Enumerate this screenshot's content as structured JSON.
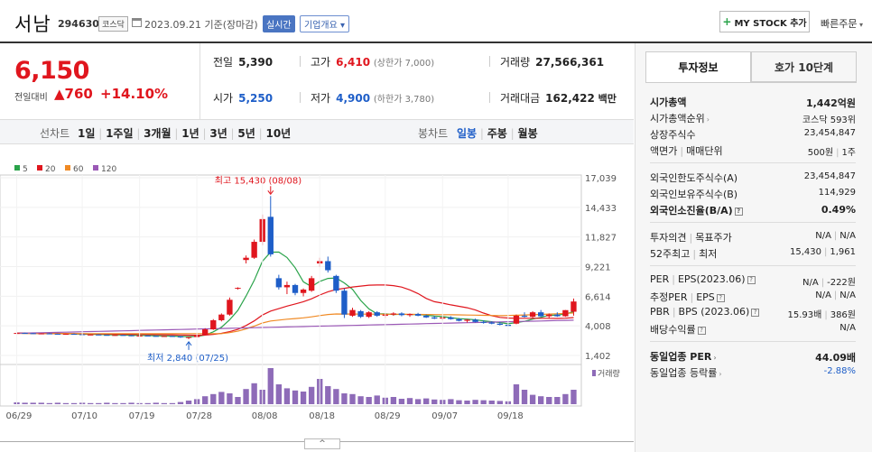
{
  "header": {
    "stock_name": "서남",
    "stock_code": "294630",
    "market": "코스닥",
    "date": "2023.09.21 기준(장마감)",
    "realtime_label": "실시간",
    "company_label": "기업개요",
    "mystock_label": "MY STOCK 추가",
    "quick_order_label": "빠른주문"
  },
  "price": {
    "current": "6,150",
    "change_label": "전일대비",
    "change_value": "760",
    "change_pct": "+14.10%",
    "prev_close_label": "전일",
    "prev_close": "5,390",
    "high_label": "고가",
    "high": "6,410",
    "upper_limit": "(상한가 7,000)",
    "volume_label": "거래량",
    "volume": "27,566,361",
    "open_label": "시가",
    "open": "5,250",
    "low_label": "저가",
    "low": "4,900",
    "lower_limit": "(하한가 3,780)",
    "amount_label": "거래대금",
    "amount": "162,422",
    "amount_unit": "백만"
  },
  "period_bar": {
    "line_chart_label": "선차트",
    "line_items": [
      "1일",
      "1주일",
      "3개월",
      "1년",
      "3년",
      "5년",
      "10년"
    ],
    "candle_chart_label": "봉차트",
    "candle_items": [
      "일봉",
      "주봉",
      "월봉"
    ],
    "active_candle": "일봉"
  },
  "chart_data": {
    "type": "candlestick",
    "legend": [
      "5",
      "20",
      "60",
      "120"
    ],
    "legend_colors": [
      "#2aa34a",
      "#e0161e",
      "#f08a24",
      "#9b59b6"
    ],
    "yticks": [
      "17,039",
      "14,433",
      "11,827",
      "9,221",
      "6,614",
      "4,008",
      "1,402"
    ],
    "ylim": [
      1402,
      17039
    ],
    "xticks": [
      "06/29",
      "07/10",
      "07/19",
      "07/28",
      "08/08",
      "08/18",
      "08/29",
      "09/07",
      "09/18"
    ],
    "high_annotation": "최고 15,430 (08/08)",
    "low_annotation": "최저 2,840 (07/25)",
    "volume_label": "거래량",
    "candles": [
      [
        3350,
        3400,
        3330,
        3380
      ],
      [
        3380,
        3420,
        3350,
        3360
      ],
      [
        3360,
        3380,
        3300,
        3320
      ],
      [
        3320,
        3360,
        3280,
        3340
      ],
      [
        3340,
        3380,
        3300,
        3310
      ],
      [
        3310,
        3330,
        3250,
        3280
      ],
      [
        3280,
        3320,
        3240,
        3300
      ],
      [
        3300,
        3340,
        3260,
        3270
      ],
      [
        3270,
        3290,
        3200,
        3220
      ],
      [
        3220,
        3260,
        3180,
        3240
      ],
      [
        3240,
        3280,
        3200,
        3210
      ],
      [
        3210,
        3240,
        3150,
        3180
      ],
      [
        3180,
        3220,
        3140,
        3200
      ],
      [
        3200,
        3230,
        3160,
        3170
      ],
      [
        3170,
        3200,
        3100,
        3130
      ],
      [
        3130,
        3170,
        3090,
        3150
      ],
      [
        3150,
        3180,
        3110,
        3120
      ],
      [
        3120,
        3150,
        3060,
        3090
      ],
      [
        3090,
        3130,
        3050,
        3110
      ],
      [
        3110,
        3140,
        3070,
        3080
      ],
      [
        3080,
        3110,
        2950,
        2990
      ],
      [
        2990,
        3040,
        2840,
        3020
      ],
      [
        3020,
        3250,
        2980,
        3200
      ],
      [
        3200,
        3800,
        3150,
        3700
      ],
      [
        3700,
        4600,
        3650,
        4500
      ],
      [
        4500,
        5100,
        4400,
        5000
      ],
      [
        5000,
        6500,
        4900,
        6300
      ],
      [
        7300,
        7400,
        7200,
        7350
      ],
      [
        9800,
        10200,
        9500,
        10000
      ],
      [
        10000,
        11600,
        9900,
        11400
      ],
      [
        11400,
        13800,
        11100,
        13400
      ],
      [
        13600,
        15430,
        10100,
        10300
      ],
      [
        8200,
        8500,
        7200,
        7400
      ],
      [
        7400,
        7900,
        6800,
        7600
      ],
      [
        7600,
        7700,
        6700,
        6900
      ],
      [
        6900,
        7300,
        6600,
        7200
      ],
      [
        7100,
        8400,
        7000,
        8200
      ],
      [
        9500,
        10000,
        9200,
        9700
      ],
      [
        9700,
        10100,
        8700,
        8900
      ],
      [
        8400,
        8500,
        6900,
        7100
      ],
      [
        7100,
        7300,
        4700,
        5000
      ],
      [
        4900,
        5600,
        4800,
        5400
      ],
      [
        5300,
        5400,
        4700,
        4800
      ],
      [
        4800,
        5300,
        4700,
        5200
      ],
      [
        5200,
        5300,
        4800,
        4900
      ],
      [
        4900,
        5100,
        4700,
        5000
      ],
      [
        5000,
        5200,
        4900,
        5100
      ],
      [
        5100,
        5200,
        4850,
        4950
      ],
      [
        4950,
        5100,
        4800,
        5050
      ],
      [
        5050,
        5150,
        4850,
        4900
      ],
      [
        4900,
        5000,
        4700,
        4750
      ],
      [
        4750,
        4900,
        4600,
        4650
      ],
      [
        4650,
        4800,
        4500,
        4750
      ],
      [
        4750,
        4850,
        4550,
        4600
      ],
      [
        4600,
        4700,
        4400,
        4450
      ],
      [
        4450,
        4600,
        4300,
        4550
      ],
      [
        4550,
        4650,
        4300,
        4350
      ],
      [
        4350,
        4500,
        4200,
        4300
      ],
      [
        4300,
        4400,
        4150,
        4200
      ],
      [
        4200,
        4350,
        4050,
        4100
      ],
      [
        4100,
        4200,
        3950,
        4000
      ],
      [
        4200,
        5000,
        4150,
        4900
      ],
      [
        4900,
        5200,
        4750,
        4800
      ],
      [
        4800,
        5300,
        4700,
        5200
      ],
      [
        5200,
        5400,
        4800,
        4850
      ],
      [
        4850,
        5100,
        4700,
        5000
      ],
      [
        5000,
        5200,
        4800,
        4850
      ],
      [
        4850,
        5400,
        4800,
        5390
      ],
      [
        5250,
        6410,
        4900,
        6150
      ]
    ],
    "volumes": [
      5,
      4,
      4,
      4,
      3,
      4,
      3,
      3,
      4,
      3,
      3,
      4,
      3,
      3,
      4,
      3,
      3,
      4,
      3,
      3,
      6,
      10,
      14,
      22,
      28,
      34,
      30,
      20,
      42,
      58,
      40,
      100,
      55,
      44,
      38,
      35,
      48,
      70,
      50,
      42,
      30,
      28,
      22,
      20,
      24,
      18,
      20,
      15,
      17,
      14,
      16,
      13,
      12,
      14,
      11,
      10,
      12,
      11,
      10,
      9,
      8,
      55,
      40,
      26,
      22,
      20,
      20,
      28,
      40
    ]
  },
  "tabs": {
    "active": "투자정보",
    "inactive": "호가 10단계"
  },
  "invest_info": {
    "s1": [
      {
        "label": "시가총액",
        "value": "1,442억원",
        "bold": true
      },
      {
        "label": "시가총액순위",
        "value": "코스닥 593위",
        "arrow": true
      },
      {
        "label": "상장주식수",
        "value": "23,454,847"
      },
      {
        "label": "액면가",
        "label2": "매매단위",
        "value": "500원",
        "value2": "1주"
      }
    ],
    "s2": [
      {
        "label": "외국인한도주식수(A)",
        "value": "23,454,847"
      },
      {
        "label": "외국인보유주식수(B)",
        "value": "114,929"
      },
      {
        "label": "외국인소진율(B/A)",
        "value": "0.49%",
        "bold": true,
        "q": true
      }
    ],
    "s3": [
      {
        "label": "투자의견",
        "label2": "목표주가",
        "value": "N/A",
        "value2": "N/A"
      },
      {
        "label": "52주최고",
        "label2": "최저",
        "value": "15,430",
        "value2": "1,961"
      }
    ],
    "s4": [
      {
        "label": "PER",
        "label2": "EPS(2023.06)",
        "value": "N/A",
        "value2": "-222원",
        "q": true
      },
      {
        "label": "추정PER",
        "label2": "EPS",
        "value": "N/A",
        "value2": "N/A",
        "q": true
      },
      {
        "label": "PBR",
        "label2": "BPS (2023.06)",
        "value": "15.93배",
        "value2": "386원",
        "q": true
      },
      {
        "label": "배당수익률",
        "value": "N/A",
        "q": true
      }
    ],
    "s5": [
      {
        "label": "동일업종 PER",
        "value": "44.09배",
        "bold": true,
        "arrow": true
      },
      {
        "label": "동일업종 등락률",
        "value": "-2.88%",
        "arrow": true,
        "blue": true
      }
    ]
  },
  "toggle_label": "^"
}
